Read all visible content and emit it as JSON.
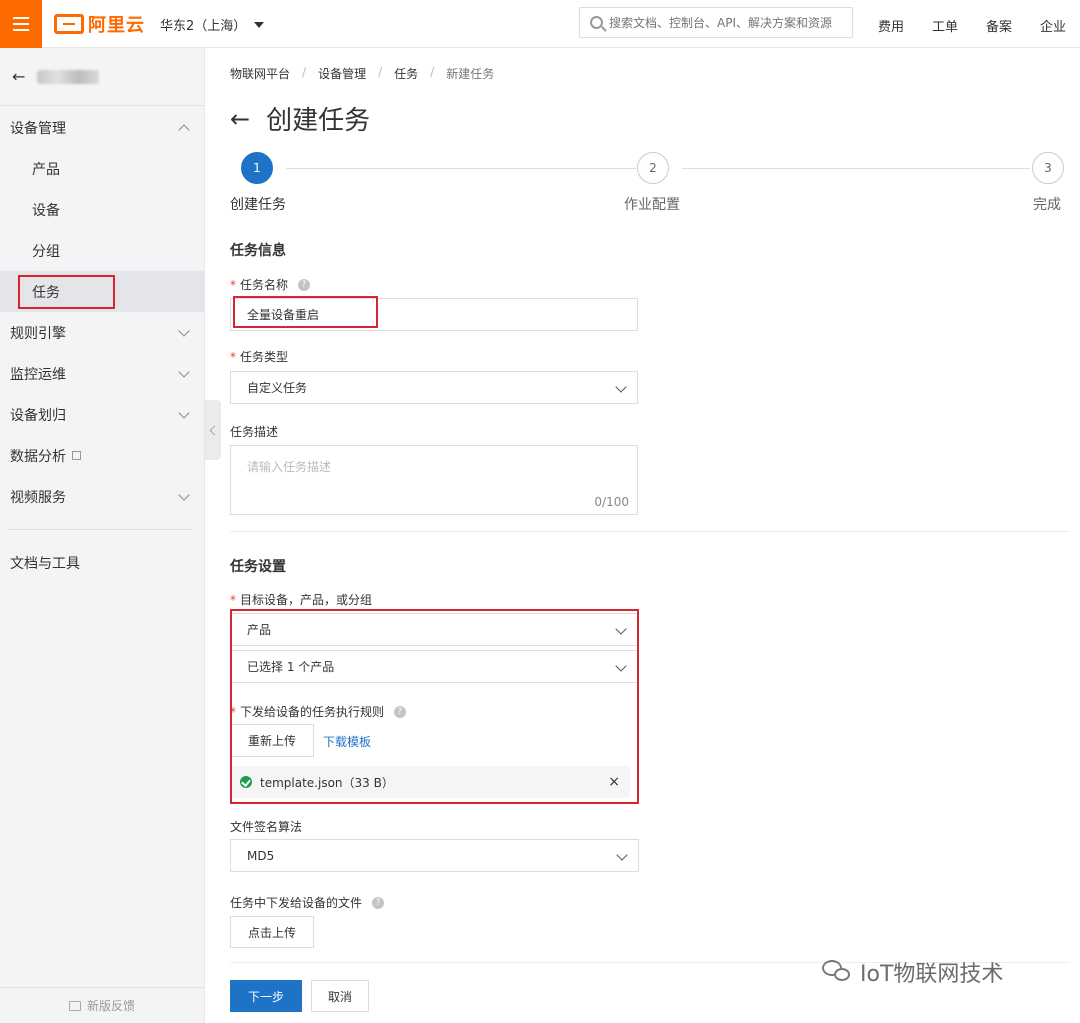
{
  "topbar": {
    "logo_text": "阿里云",
    "region": "华东2（上海）",
    "search_placeholder": "搜索文档、控制台、API、解决方案和资源",
    "links": [
      "费用",
      "工单",
      "备案",
      "企业"
    ]
  },
  "sidebar": {
    "groups": [
      {
        "label": "设备管理",
        "items": [
          "产品",
          "设备",
          "分组",
          "任务"
        ]
      },
      {
        "label": "规则引擎"
      },
      {
        "label": "监控运维"
      },
      {
        "label": "设备划归"
      },
      {
        "label": "数据分析"
      },
      {
        "label": "视频服务"
      }
    ],
    "docs": "文档与工具",
    "feedback": "新版反馈"
  },
  "breadcrumb": [
    "物联网平台",
    "设备管理",
    "任务",
    "新建任务"
  ],
  "page_title": "创建任务",
  "steps": [
    {
      "num": "1",
      "label": "创建任务"
    },
    {
      "num": "2",
      "label": "作业配置"
    },
    {
      "num": "3",
      "label": "完成"
    }
  ],
  "task_info": {
    "section": "任务信息",
    "name_label": "任务名称",
    "name_value": "全量设备重启",
    "type_label": "任务类型",
    "type_value": "自定义任务",
    "desc_label": "任务描述",
    "desc_placeholder": "请输入任务描述",
    "desc_counter": "0/100"
  },
  "task_settings": {
    "section": "任务设置",
    "target_label": "目标设备，产品，或分组",
    "target_value": "产品",
    "selected_value": "已选择 1 个产品",
    "rule_label": "下发给设备的任务执行规则",
    "reupload": "重新上传",
    "download_template": "下载模板",
    "file_name": "template.json（33 B）",
    "close": "×",
    "sign_label": "文件签名算法",
    "sign_value": "MD5",
    "file_label": "任务中下发给设备的文件",
    "upload": "点击上传"
  },
  "footer": {
    "next": "下一步",
    "cancel": "取消"
  },
  "watermark": "IoT物联网技术",
  "colors": {
    "brand": "#ff6a00",
    "primary": "#1f73c7",
    "highlight": "#d7262f",
    "success": "#1e9e4a"
  }
}
